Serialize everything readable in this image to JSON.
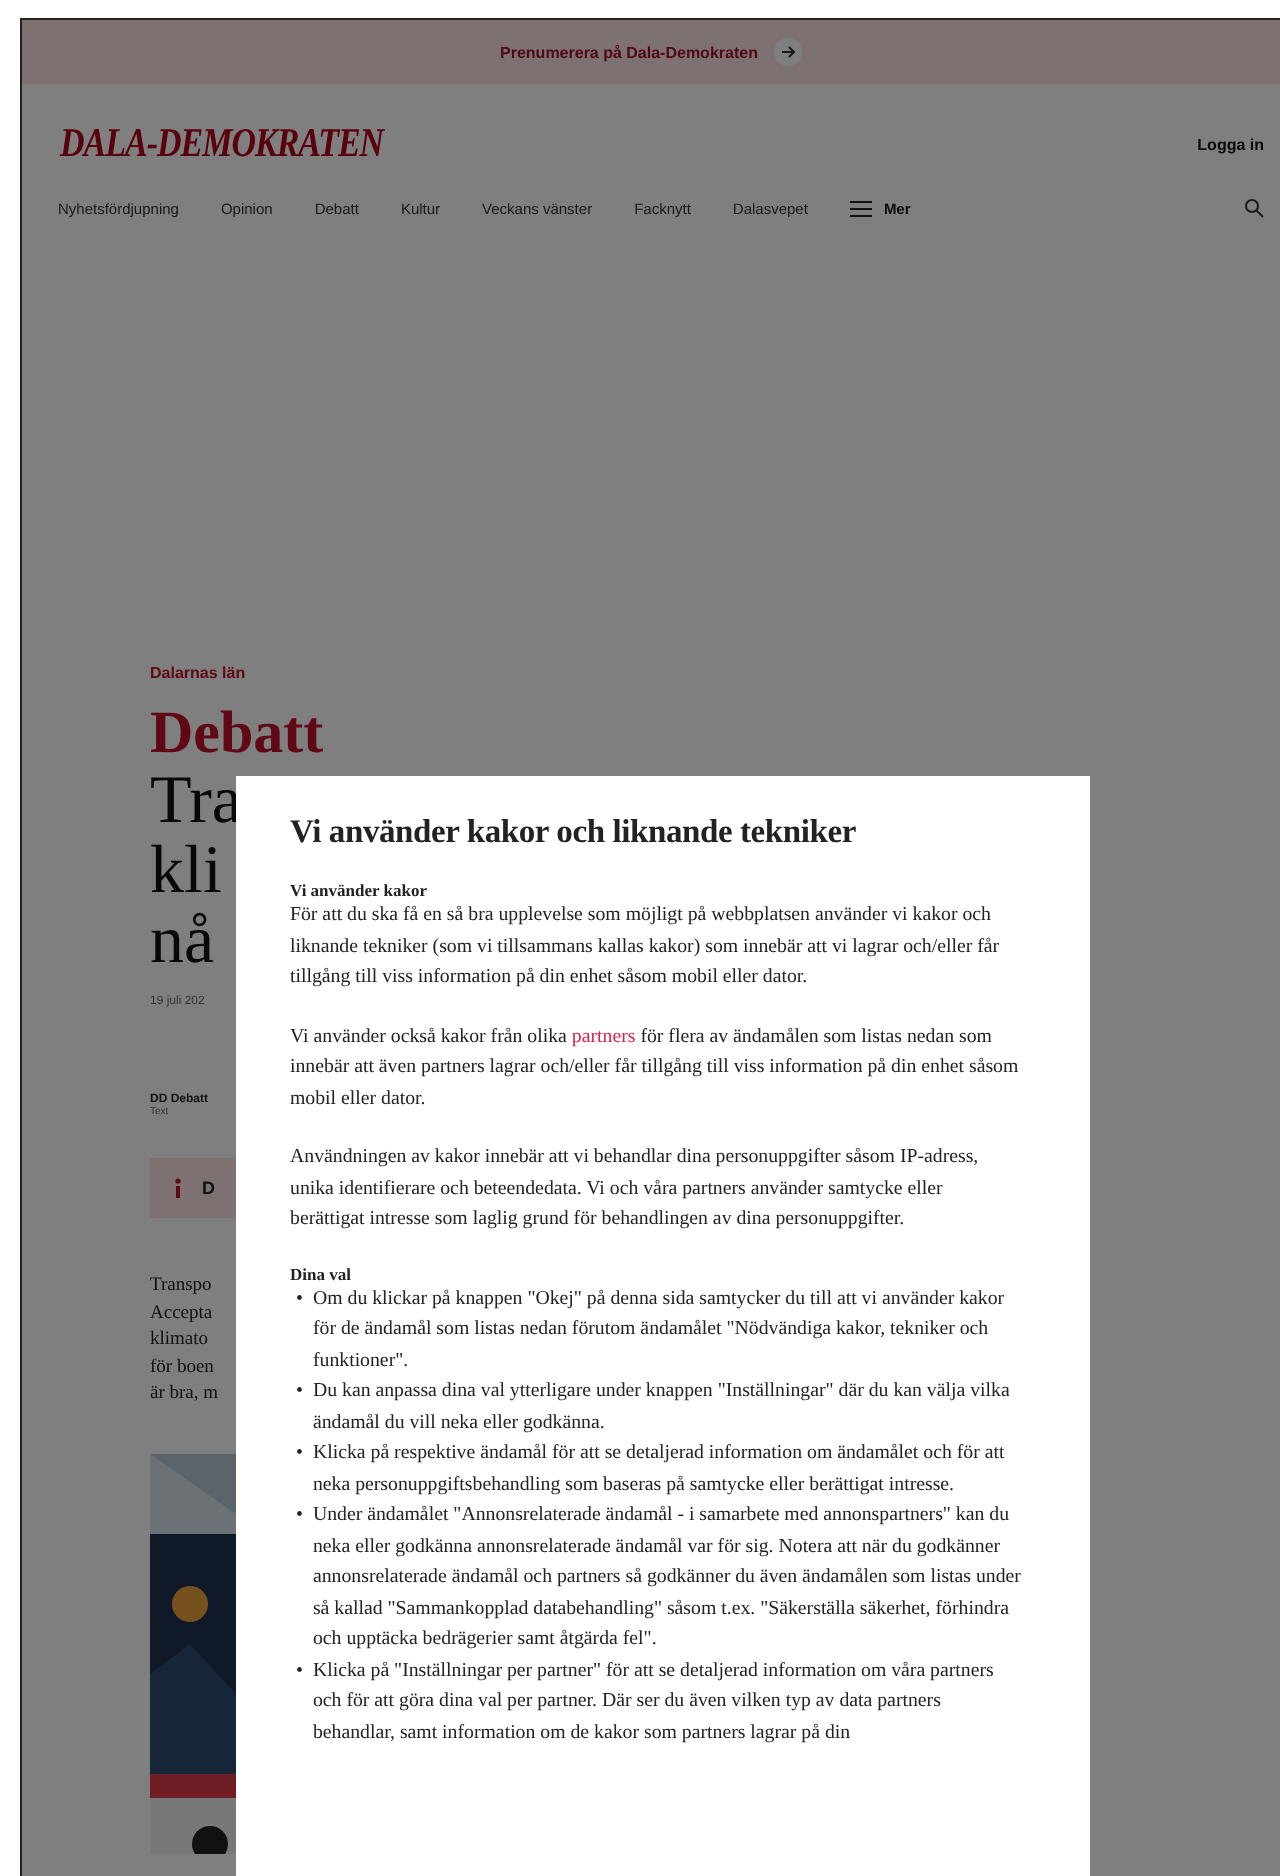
{
  "banner": {
    "text": "Prenumerera på Dala-Demokraten"
  },
  "header": {
    "logo": "DALA-DEMOKRATEN",
    "login": "Logga in"
  },
  "nav": {
    "items": [
      "Nyhetsfördjupning",
      "Opinion",
      "Debatt",
      "Kultur",
      "Veckans vänster",
      "Facknytt",
      "Dalasvepet"
    ],
    "more": "Mer"
  },
  "article": {
    "section": "Dalarnas län",
    "category": "Debatt",
    "headline_lines": [
      "Tra",
      "kli",
      "nå"
    ],
    "date": "19 juli 202",
    "author": "DD Debatt",
    "author_role": "Text",
    "notice": "D",
    "body_lines": [
      "Transpo",
      "Accepta",
      "klimato",
      "för boen",
      "är bra, m"
    ]
  },
  "cookie_dialog": {
    "title": "Vi använder kakor och liknande tekniker",
    "sections": [
      {
        "heading": "Vi använder kakor",
        "paragraphs": [
          {
            "before": "För att du ska få en så bra upplevelse som möjligt på webbplatsen använder vi kakor och liknande tekniker (som vi tillsammans kallas kakor) som innebär att vi lagrar och/eller får tillgång till viss information på din enhet såsom mobil eller dator."
          },
          {
            "before": "Vi använder också kakor från olika ",
            "link": "partners",
            "after": " för flera av ändamålen som listas nedan som innebär att även partners lagrar och/eller får tillgång till viss information på din enhet såsom mobil eller dator."
          },
          {
            "before": "Användningen av kakor innebär att vi behandlar dina personuppgifter såsom IP-adress, unika identifierare och beteendedata. Vi och våra partners använder samtycke eller berättigat intresse som laglig grund för behandlingen av dina personuppgifter."
          }
        ]
      },
      {
        "heading": "Dina val",
        "marker": "•",
        "bullets": [
          "Om du klickar på knappen \"Okej\" på denna sida samtycker du till att vi använder kakor för de ändamål som listas nedan förutom ändamålet \"Nödvändiga kakor, tekniker och funktioner\".",
          "Du kan anpassa dina val ytterligare under knappen \"Inställningar\" där du kan välja vilka ändamål du vill neka eller godkänna.",
          "Klicka på respektive ändamål för att se detaljerad information om ändamålet och för att neka personuppgiftsbehandling som baseras på samtycke eller berättigat intresse.",
          "Under ändamålet \"Annonsrelaterade ändamål - i samarbete med annonspartners\" kan du neka eller godkänna annonsrelaterade ändamål var för sig. Notera att när du godkänner annonsrelaterade ändamål och partners så godkänner du även ändamålen som listas under så kallad \"Sammankopplad databehandling\" såsom t.ex. \"Säkerställa säkerhet, förhindra och upptäcka bedrägerier samt åtgärda fel\".",
          "Klicka på \"Inställningar per partner\" för att se detaljerad information om våra partners och för att göra dina val per partner. Där ser du även vilken typ av data partners behandlar, samt information om de kakor som partners lagrar på din"
        ]
      }
    ]
  }
}
